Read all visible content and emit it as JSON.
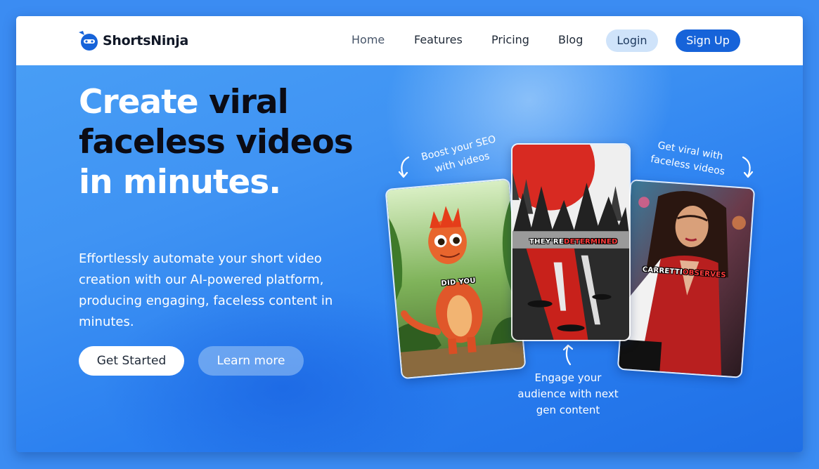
{
  "brand": {
    "name": "ShortsNinja",
    "accent": "#1663d9"
  },
  "nav": {
    "home": "Home",
    "features": "Features",
    "pricing": "Pricing",
    "blog": "Blog",
    "login": "Login",
    "signup": "Sign Up"
  },
  "hero": {
    "title_1": "Create ",
    "title_2": "viral faceless videos",
    "title_3": " in minutes.",
    "description": "Effortlessly automate your short video creation with our AI-powered platform, producing engaging, faceless content in minutes.",
    "cta_primary": "Get Started",
    "cta_secondary": "Learn more"
  },
  "showcase": {
    "label_left": "Boost your SEO with videos",
    "label_right": "Get viral with faceless videos",
    "label_bottom": "Engage your audience with next gen content",
    "card_left_caption_1": "DID",
    "card_left_caption_2": "YOU",
    "card_mid_caption_1": "THEY'RE",
    "card_mid_caption_2": "DETERMINED",
    "card_right_caption_1": "CARRETTI",
    "card_right_caption_2": "OBSERVES"
  }
}
